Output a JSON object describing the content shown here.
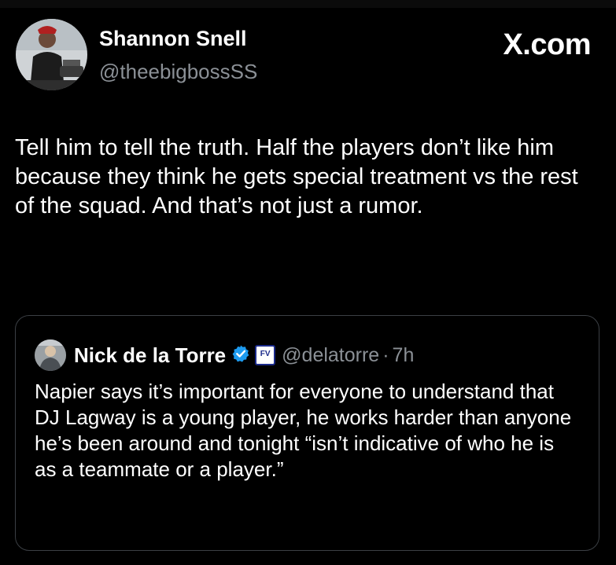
{
  "post": {
    "author_name": "Shannon Snell",
    "author_handle": "@theebigbossSS",
    "brand": "X.com",
    "text": "Tell him to tell the truth. Half the players don’t like him because they think he gets special treatment vs the rest of the squad. And that’s not just a rumor.",
    "avatar_icon": "profile-photo"
  },
  "quote": {
    "author_name": "Nick de la Torre",
    "verified_icon": "verified-badge",
    "verified_color": "#1d9bf0",
    "affiliate_badge_label": "FV",
    "affiliate_color": "#1b2a8a",
    "author_handle": "@delatorre",
    "separator": "·",
    "time": "7h",
    "text": "Napier says it’s important for everyone to understand that DJ Lagway is a young player, he works harder than anyone he’s been around and tonight “isn’t indicative of who he is as a teammate or a player.”"
  },
  "colors": {
    "background": "#000000",
    "text_primary": "#ffffff",
    "text_secondary": "#8b9096",
    "border": "#3b3f44"
  }
}
